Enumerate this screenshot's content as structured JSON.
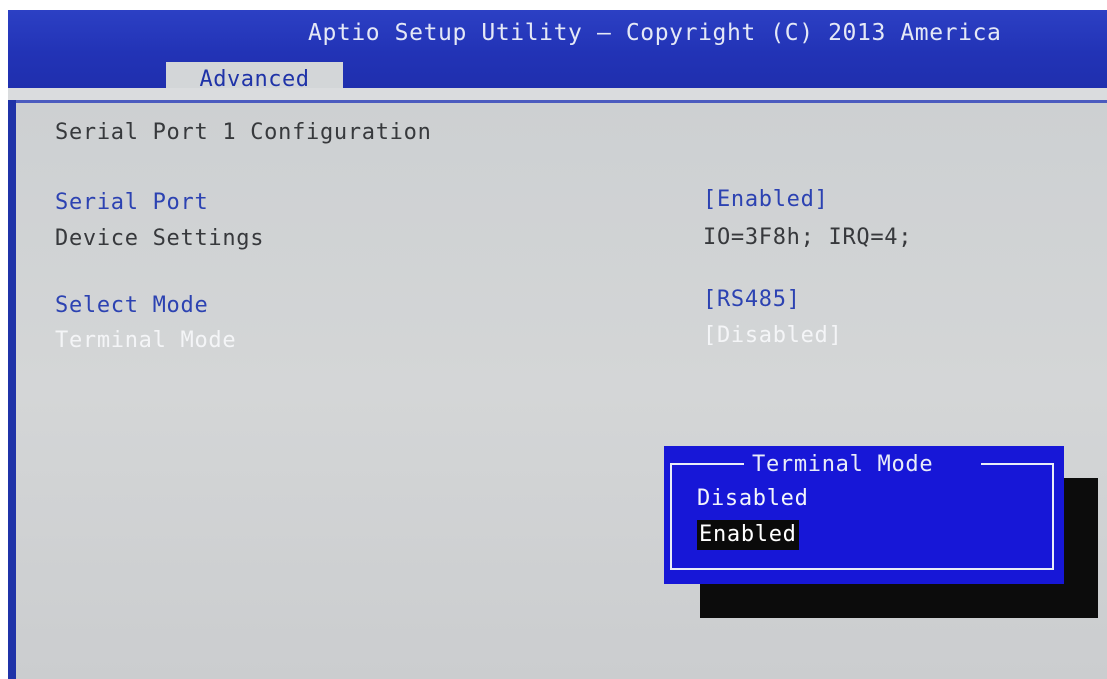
{
  "header": {
    "title": "Aptio Setup Utility – Copyright (C) 2013 America",
    "active_tab": "Advanced"
  },
  "main": {
    "section_title": "Serial Port 1 Configuration",
    "settings": [
      {
        "label": "Serial Port",
        "value": "[Enabled]"
      },
      {
        "label": "Device Settings",
        "value": "IO=3F8h; IRQ=4;"
      },
      {
        "label": "Select Mode",
        "value": "[RS485]"
      },
      {
        "label": "Terminal Mode",
        "value": "[Disabled]",
        "highlighted": true
      }
    ]
  },
  "popup": {
    "title": "Terminal Mode",
    "options": [
      "Disabled",
      "Enabled"
    ],
    "selected_option": "Enabled"
  },
  "colors": {
    "title_bar": "#2233b6",
    "panel_bg": "#d3d6d8",
    "accent_blue_text": "#2c42b2",
    "popup_bg": "#1717d7",
    "popup_shadow": "#0c0c0c"
  }
}
